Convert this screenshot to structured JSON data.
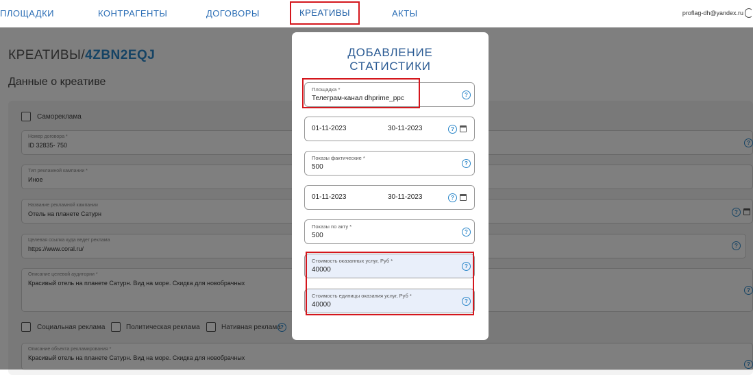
{
  "nav": {
    "items": [
      "ПЛОЩАДКИ",
      "КОНТРАГЕНТЫ",
      "ДОГОВОРЫ",
      "КРЕАТИВЫ",
      "АКТЫ"
    ],
    "user_email": "proflag-dh@yandex.ru"
  },
  "page": {
    "title_prefix": "КРЕАТИВЫ/",
    "title_code": "4ZBN2EQJ",
    "section_title": "Данные о креативе"
  },
  "form": {
    "self_ad_label": "Самореклама",
    "contract_number": {
      "label": "Номер договора *",
      "value": "ID 32835- 750"
    },
    "campaign_type": {
      "label": "Тип рекламной кампании *",
      "value": "Иное"
    },
    "campaign_name": {
      "label": "Название рекламной кампании",
      "value": "Отель на планете Сатурн"
    },
    "target_link": {
      "label": "Целевая ссылка куда ведет реклама",
      "value": "https://www.coral.ru/"
    },
    "audience": {
      "label": "Описание целевой аудитории *",
      "value": "Красивый отель на планете Сатурн. Вид на море. Скидка для новобрачных"
    },
    "social_label": "Социальная реклама",
    "political_label": "Политическая реклама",
    "native_label": "Нативная реклама",
    "object_desc": {
      "label": "Описание объекта рекламирования *",
      "value": "Красивый отель на планете Сатурн. Вид на море. Скидка для новобрачных"
    }
  },
  "modal": {
    "title_line1": "ДОБАВЛЕНИЕ",
    "title_line2": "СТАТИСТИКИ",
    "platform": {
      "label": "Площадка *",
      "value": "Телеграм-канал dhprime_ppc"
    },
    "period1": {
      "start": "01-11-2023",
      "end": "30-11-2023"
    },
    "actual_impressions": {
      "label": "Показы фактические *",
      "value": "500"
    },
    "period2": {
      "start": "01-11-2023",
      "end": "30-11-2023"
    },
    "act_impressions": {
      "label": "Показы по акту *",
      "value": "500"
    },
    "service_cost": {
      "label": "Стоимость оказанных услуг, Руб *",
      "value": "40000"
    },
    "unit_cost": {
      "label": "Стоимость единицы оказания услуг, Руб *",
      "value": "40000"
    },
    "help_glyph": "?"
  },
  "colors": {
    "accent": "#2a86c9",
    "highlight": "#d4161c",
    "title": "#2a5a93",
    "filled_field": "#e9effa"
  }
}
